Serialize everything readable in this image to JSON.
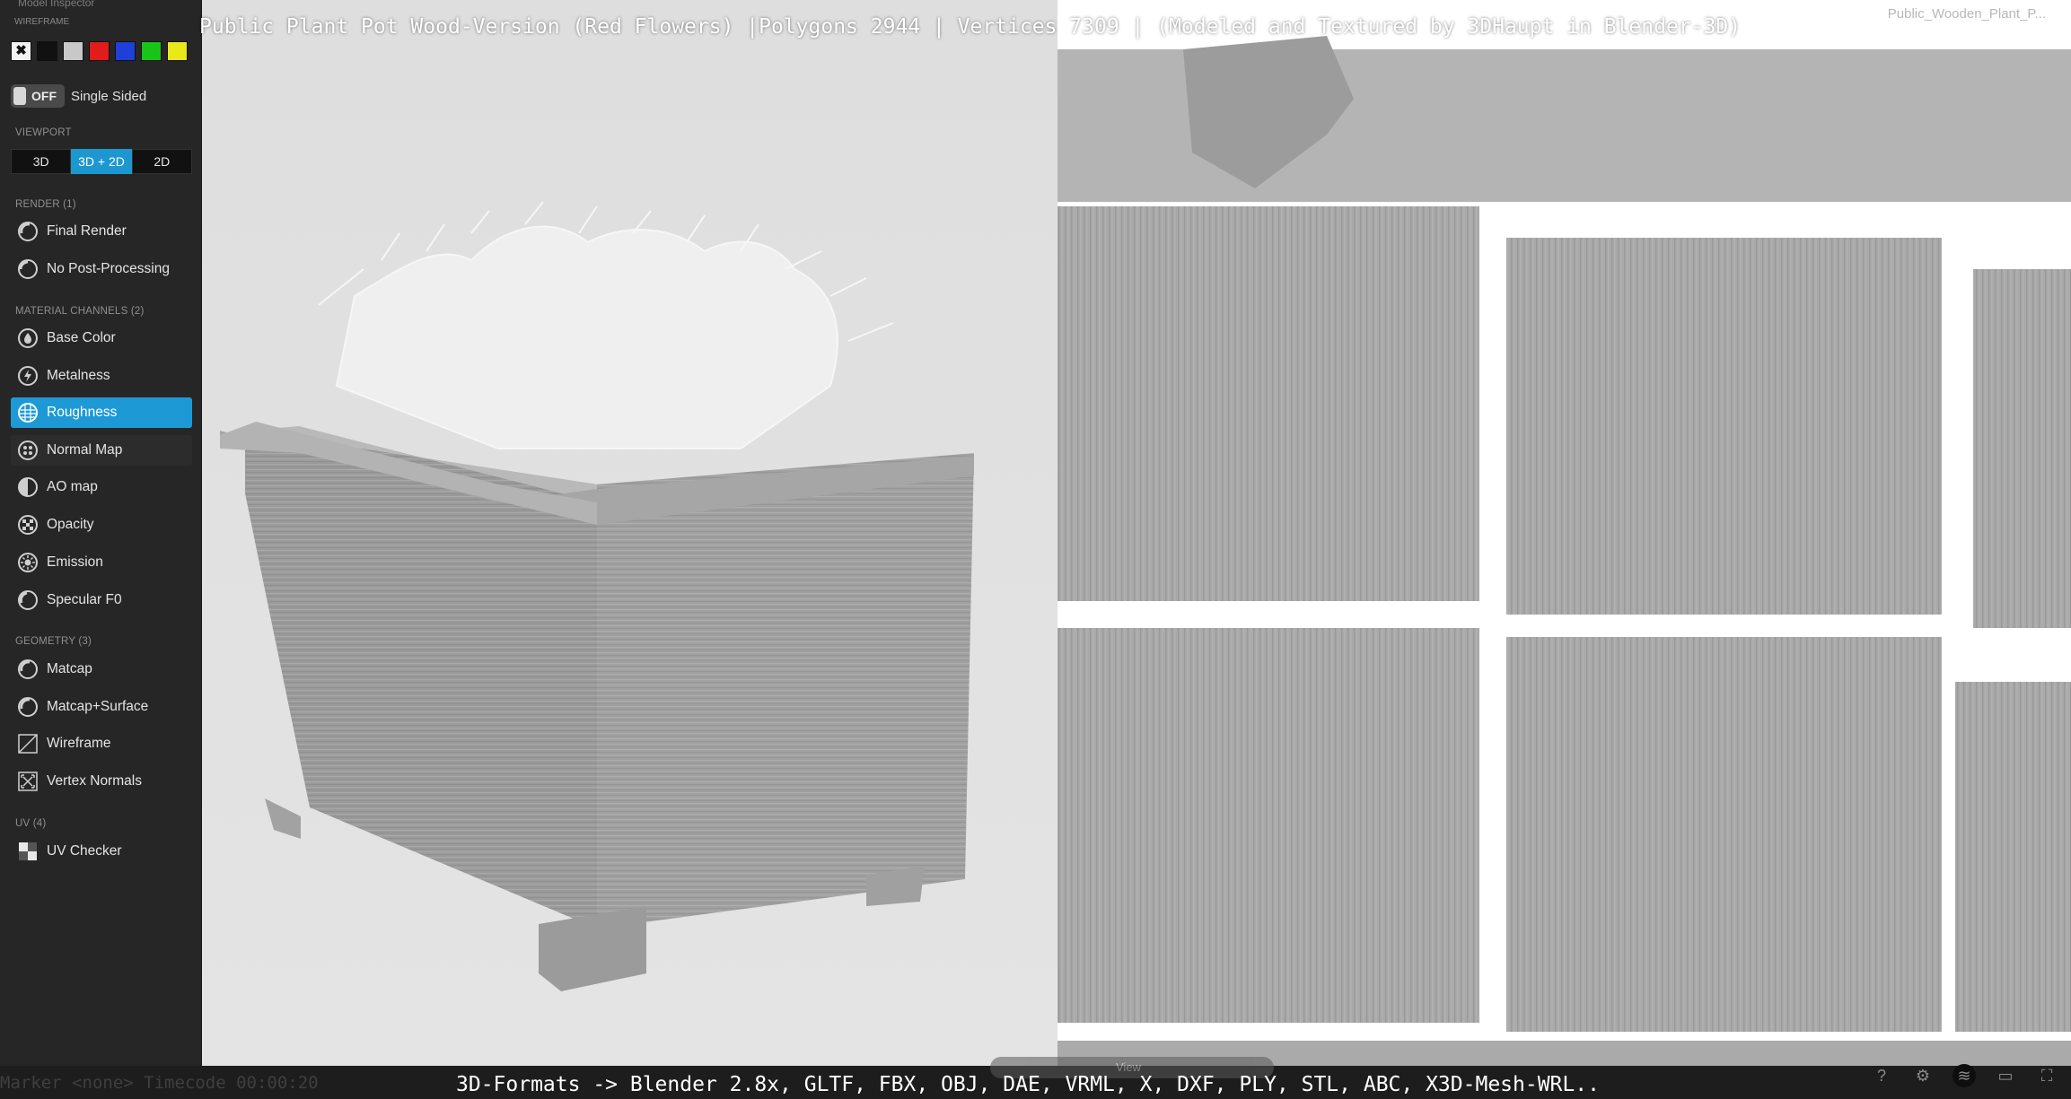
{
  "window": {
    "title": "Public Plant Pot Wood-Version (Red Flowers) |Polygons 2944 | Vertices 7309 | (Modeled and Textured by 3DHaupt in Blender-3D)",
    "right_label": "Public_Wooden_Plant_P..."
  },
  "sidebar": {
    "header": "Model Inspector",
    "wireframe_label": "Wireframe",
    "swatches": [
      "#f2f2f2",
      "#111111",
      "#c8c8c8",
      "#e21b1b",
      "#1f3fd8",
      "#19c419",
      "#e8e81a"
    ],
    "toggle": {
      "state": "OFF",
      "label": "Single Sided"
    },
    "viewport": {
      "section": "VIEWPORT",
      "buttons": [
        "3D",
        "3D + 2D",
        "2D"
      ],
      "active": "3D + 2D"
    },
    "render": {
      "section": "RENDER (1)",
      "items": [
        {
          "label": "Final Render",
          "icon": "final-render-icon"
        },
        {
          "label": "No Post-Processing",
          "icon": "post-processing-icon"
        }
      ]
    },
    "material": {
      "section": "MATERIAL CHANNELS (2)",
      "items": [
        {
          "label": "Base Color",
          "icon": "base-color-icon"
        },
        {
          "label": "Metalness",
          "icon": "metalness-icon"
        },
        {
          "label": "Roughness",
          "icon": "roughness-icon",
          "active": true
        },
        {
          "label": "Normal Map",
          "icon": "normal-map-icon"
        },
        {
          "label": "AO map",
          "icon": "ao-map-icon"
        },
        {
          "label": "Opacity",
          "icon": "opacity-icon"
        },
        {
          "label": "Emission",
          "icon": "emission-icon"
        },
        {
          "label": "Specular F0",
          "icon": "specular-icon"
        }
      ]
    },
    "geometry": {
      "section": "GEOMETRY (3)",
      "items": [
        {
          "label": "Matcap",
          "icon": "matcap-icon"
        },
        {
          "label": "Matcap+Surface",
          "icon": "matcap-surface-icon"
        },
        {
          "label": "Wireframe",
          "icon": "wireframe-icon"
        },
        {
          "label": "Vertex Normals",
          "icon": "vertex-normals-icon"
        }
      ]
    },
    "uv": {
      "section": "UV (4)",
      "items": [
        {
          "label": "UV Checker",
          "icon": "uv-checker-icon"
        }
      ]
    }
  },
  "bottom": {
    "formats": "3D-Formats -> Blender 2.8x, GLTF, FBX, OBJ, DAE, VRML, X, DXF, PLY, STL, ABC, X3D-Mesh-WRL..",
    "left_text": "Marker <none>   Timecode 00:00:20",
    "view_label": "View"
  }
}
